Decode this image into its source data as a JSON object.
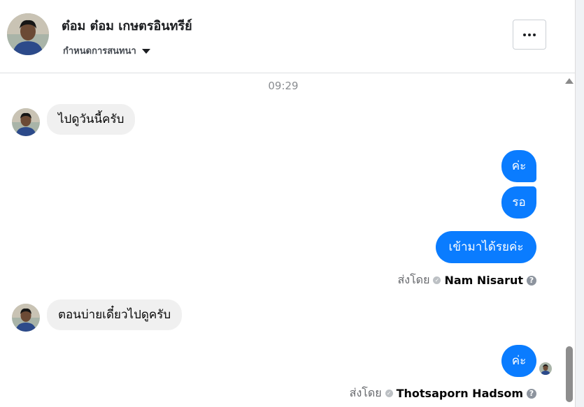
{
  "contact": {
    "name": "ต๋อม ต๋อม เกษตรอินทรีย์",
    "subtitle": "กำหนดการสนทนา"
  },
  "timestamp": "09:29",
  "messages": [
    {
      "direction": "in",
      "text": "ไปดูวันนี้ครับ"
    },
    {
      "direction": "out",
      "text": "ค่ะ"
    },
    {
      "direction": "out",
      "text": "รอ"
    },
    {
      "direction": "out",
      "text": "เข้ามาได้รยค่ะ"
    },
    {
      "direction": "in",
      "text": "ตอนบ่ายเดี๋ยวไปดูครับ"
    },
    {
      "direction": "out",
      "text": "ค่ะ"
    }
  ],
  "sent_by": [
    {
      "label": "ส่งโดย",
      "name": "Nam Nisarut"
    },
    {
      "label": "ส่งโดย",
      "name": "Thotsaporn Hadsom"
    }
  ],
  "icons": {
    "more": "more-options-icon",
    "caret": "caret-down-icon",
    "verified": "check-icon",
    "help": "help-icon"
  },
  "colors": {
    "outgoing_bubble": "#0a7cff",
    "incoming_bubble": "#f0f0f0"
  }
}
